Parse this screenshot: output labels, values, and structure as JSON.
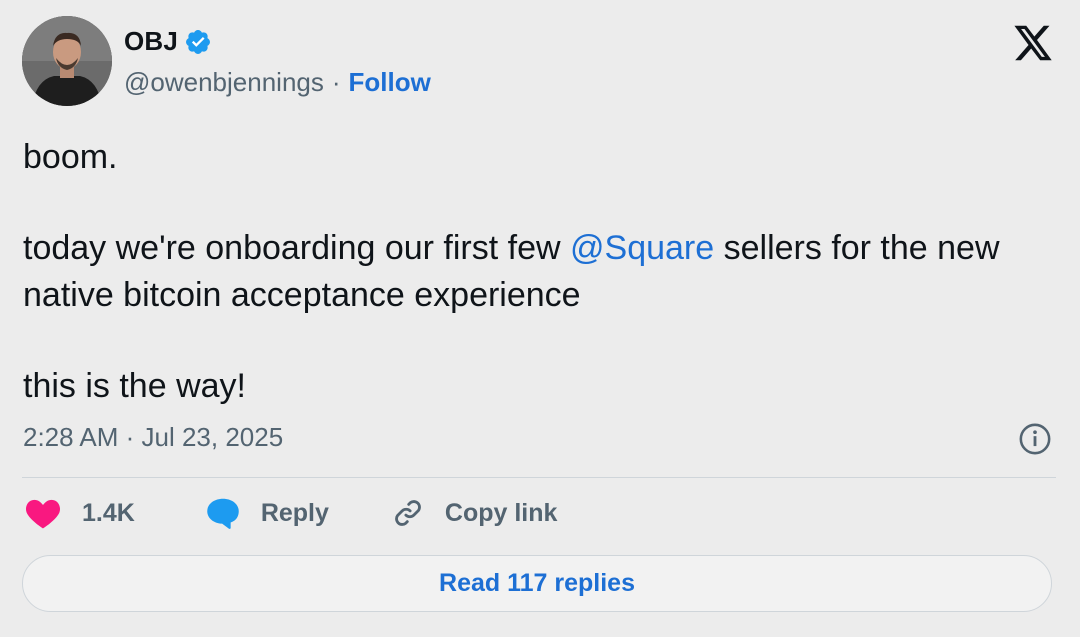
{
  "author": {
    "name": "OBJ",
    "handle": "@owenbjennings",
    "separator": "·",
    "follow_label": "Follow",
    "verified_color": "#1d9bf0"
  },
  "tweet": {
    "line1": "boom.",
    "line2_before": "today we're onboarding our first few ",
    "line2_mention": "@Square",
    "line2_after": " sellers for the new native bitcoin acceptance experience",
    "line3": "this is the way!",
    "timestamp": "2:28 AM · Jul 23, 2025"
  },
  "actions": {
    "like_count": "1.4K",
    "reply_label": "Reply",
    "copy_link_label": "Copy link"
  },
  "footer": {
    "read_replies_label": "Read 117 replies"
  },
  "colors": {
    "accent": "#1d6fd4",
    "like": "#f91880",
    "reply_icon": "#1d9bf0",
    "muted": "#536471"
  },
  "icons": [
    "verified-badge-icon",
    "x-logo-icon",
    "info-icon",
    "heart-icon",
    "reply-bubble-icon",
    "link-icon"
  ]
}
